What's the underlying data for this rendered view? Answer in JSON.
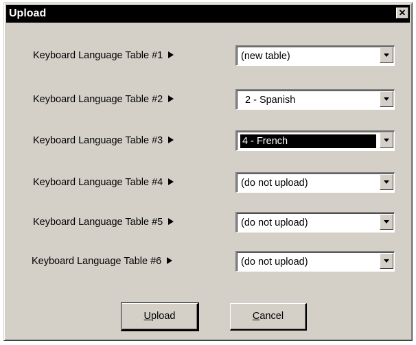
{
  "window": {
    "title": "Upload",
    "close_glyph": "✕"
  },
  "rows": [
    {
      "label": "Keyboard Language Table #1",
      "value": "(new table)"
    },
    {
      "label": "Keyboard Language Table #2",
      "value": "2 - Spanish"
    },
    {
      "label": "Keyboard Language Table #3",
      "value": "4 - French"
    },
    {
      "label": "Keyboard Language Table #4",
      "value": "(do not upload)"
    },
    {
      "label": "Keyboard Language Table #5",
      "value": "(do not upload)"
    },
    {
      "label": "Keyboard Language Table #6",
      "value": "(do not upload)"
    }
  ],
  "buttons": {
    "upload": {
      "mnemonic": "U",
      "rest": "pload"
    },
    "cancel": {
      "mnemonic": "C",
      "rest": "ancel"
    }
  },
  "icons": {
    "row_arrow": "arrow-right-icon",
    "dropdown": "chevron-down-icon",
    "close": "close-icon"
  },
  "colors": {
    "face": "#d4d0c8",
    "titlebar": "#000000",
    "selection": "#000000"
  }
}
